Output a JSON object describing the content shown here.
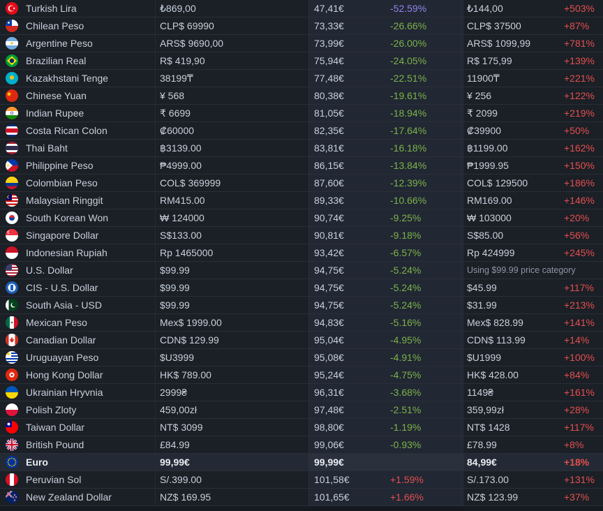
{
  "colors": {
    "green_pct": "#7db24a",
    "red_pct": "#e2504f",
    "purple_pct": "#8f85e6",
    "row_bg": "#1b1f26",
    "highlight_bg": "#242a35"
  },
  "rows": [
    {
      "currency": "Turkish Lira",
      "flag": "turkey-flag-icon",
      "price": "₺869,00",
      "eur": "47,41€",
      "pct": "-52.59%",
      "regional": "₺144,00",
      "regional_pct": "+503%"
    },
    {
      "currency": "Chilean Peso",
      "flag": "chile-flag-icon",
      "price": "CLP$ 69990",
      "eur": "73,33€",
      "pct": "-26.66%",
      "regional": "CLP$ 37500",
      "regional_pct": "+87%"
    },
    {
      "currency": "Argentine Peso",
      "flag": "argentina-flag-icon",
      "price": "ARS$ 9690,00",
      "eur": "73,99€",
      "pct": "-26.00%",
      "regional": "ARS$ 1099,99",
      "regional_pct": "+781%"
    },
    {
      "currency": "Brazilian Real",
      "flag": "brazil-flag-icon",
      "price": "R$ 419,90",
      "eur": "75,94€",
      "pct": "-24.05%",
      "regional": "R$ 175,99",
      "regional_pct": "+139%"
    },
    {
      "currency": "Kazakhstani Tenge",
      "flag": "kazakhstan-flag-icon",
      "price": "38199₸",
      "eur": "77,48€",
      "pct": "-22.51%",
      "regional": "11900₸",
      "regional_pct": "+221%"
    },
    {
      "currency": "Chinese Yuan",
      "flag": "china-flag-icon",
      "price": "¥ 568",
      "eur": "80,38€",
      "pct": "-19.61%",
      "regional": "¥ 256",
      "regional_pct": "+122%"
    },
    {
      "currency": "Indian Rupee",
      "flag": "india-flag-icon",
      "price": "₹ 6699",
      "eur": "81,05€",
      "pct": "-18.94%",
      "regional": "₹ 2099",
      "regional_pct": "+219%"
    },
    {
      "currency": "Costa Rican Colon",
      "flag": "costa-rica-flag-icon",
      "price": "₡60000",
      "eur": "82,35€",
      "pct": "-17.64%",
      "regional": "₡39900",
      "regional_pct": "+50%"
    },
    {
      "currency": "Thai Baht",
      "flag": "thailand-flag-icon",
      "price": "฿3139.00",
      "eur": "83,81€",
      "pct": "-16.18%",
      "regional": "฿1199.00",
      "regional_pct": "+162%"
    },
    {
      "currency": "Philippine Peso",
      "flag": "philippines-flag-icon",
      "price": "₱4999.00",
      "eur": "86,15€",
      "pct": "-13.84%",
      "regional": "₱1999.95",
      "regional_pct": "+150%"
    },
    {
      "currency": "Colombian Peso",
      "flag": "colombia-flag-icon",
      "price": "COL$ 369999",
      "eur": "87,60€",
      "pct": "-12.39%",
      "regional": "COL$ 129500",
      "regional_pct": "+186%"
    },
    {
      "currency": "Malaysian Ringgit",
      "flag": "malaysia-flag-icon",
      "price": "RM415.00",
      "eur": "89,33€",
      "pct": "-10.66%",
      "regional": "RM169.00",
      "regional_pct": "+146%"
    },
    {
      "currency": "South Korean Won",
      "flag": "south-korea-flag-icon",
      "price": "₩ 124000",
      "eur": "90,74€",
      "pct": "-9.25%",
      "regional": "₩ 103000",
      "regional_pct": "+20%"
    },
    {
      "currency": "Singapore Dollar",
      "flag": "singapore-flag-icon",
      "price": "S$133.00",
      "eur": "90,81€",
      "pct": "-9.18%",
      "regional": "S$85.00",
      "regional_pct": "+56%"
    },
    {
      "currency": "Indonesian Rupiah",
      "flag": "indonesia-flag-icon",
      "price": "Rp 1465000",
      "eur": "93,42€",
      "pct": "-6.57%",
      "regional": "Rp 424999",
      "regional_pct": "+245%"
    },
    {
      "currency": "U.S. Dollar",
      "flag": "usa-flag-icon",
      "price": "$99.99",
      "eur": "94,75€",
      "pct": "-5.24%",
      "regional": "Using $99.99 price category",
      "regional_pct": "",
      "note": true
    },
    {
      "currency": "CIS - U.S. Dollar",
      "flag": "cis-flag-icon",
      "price": "$99.99",
      "eur": "94,75€",
      "pct": "-5.24%",
      "regional": "$45.99",
      "regional_pct": "+117%"
    },
    {
      "currency": "South Asia - USD",
      "flag": "pakistan-flag-icon",
      "price": "$99.99",
      "eur": "94,75€",
      "pct": "-5.24%",
      "regional": "$31.99",
      "regional_pct": "+213%"
    },
    {
      "currency": "Mexican Peso",
      "flag": "mexico-flag-icon",
      "price": "Mex$ 1999.00",
      "eur": "94,83€",
      "pct": "-5.16%",
      "regional": "Mex$ 828.99",
      "regional_pct": "+141%"
    },
    {
      "currency": "Canadian Dollar",
      "flag": "canada-flag-icon",
      "price": "CDN$ 129.99",
      "eur": "95,04€",
      "pct": "-4.95%",
      "regional": "CDN$ 113.99",
      "regional_pct": "+14%"
    },
    {
      "currency": "Uruguayan Peso",
      "flag": "uruguay-flag-icon",
      "price": "$U3999",
      "eur": "95,08€",
      "pct": "-4.91%",
      "regional": "$U1999",
      "regional_pct": "+100%"
    },
    {
      "currency": "Hong Kong Dollar",
      "flag": "hong-kong-flag-icon",
      "price": "HK$ 789.00",
      "eur": "95,24€",
      "pct": "-4.75%",
      "regional": "HK$ 428.00",
      "regional_pct": "+84%"
    },
    {
      "currency": "Ukrainian Hryvnia",
      "flag": "ukraine-flag-icon",
      "price": "2999₴",
      "eur": "96,31€",
      "pct": "-3.68%",
      "regional": "1149₴",
      "regional_pct": "+161%"
    },
    {
      "currency": "Polish Zloty",
      "flag": "poland-flag-icon",
      "price": "459,00zł",
      "eur": "97,48€",
      "pct": "-2.51%",
      "regional": "359,99zł",
      "regional_pct": "+28%"
    },
    {
      "currency": "Taiwan Dollar",
      "flag": "taiwan-flag-icon",
      "price": "NT$ 3099",
      "eur": "98,80€",
      "pct": "-1.19%",
      "regional": "NT$ 1428",
      "regional_pct": "+117%"
    },
    {
      "currency": "British Pound",
      "flag": "uk-flag-icon",
      "price": "£84.99",
      "eur": "99,06€",
      "pct": "-0.93%",
      "regional": "£78.99",
      "regional_pct": "+8%"
    },
    {
      "currency": "Euro",
      "flag": "eu-flag-icon",
      "price": "99,99€",
      "eur": "99,99€",
      "pct": "",
      "regional": "84,99€",
      "regional_pct": "+18%",
      "highlight": true
    },
    {
      "currency": "Peruvian Sol",
      "flag": "peru-flag-icon",
      "price": "S/.399.00",
      "eur": "101,58€",
      "pct": "+1.59%",
      "regional": "S/.173.00",
      "regional_pct": "+131%"
    },
    {
      "currency": "New Zealand Dollar",
      "flag": "new-zealand-flag-icon",
      "price": "NZ$ 169.95",
      "eur": "101,65€",
      "pct": "+1.66%",
      "regional": "NZ$ 123.99",
      "regional_pct": "+37%"
    }
  ]
}
